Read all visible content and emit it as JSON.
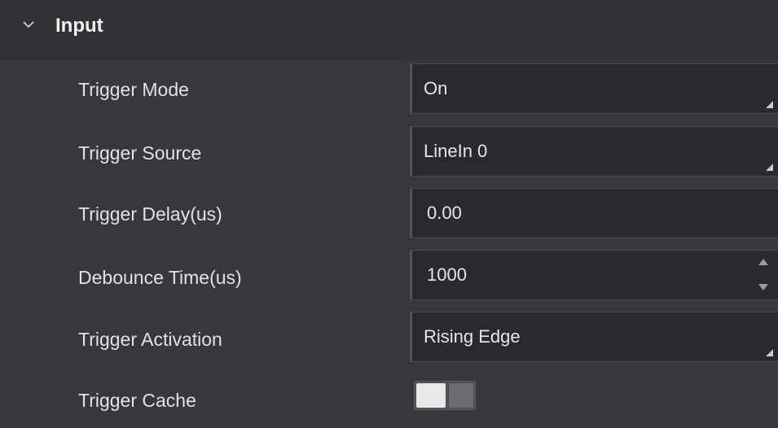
{
  "section": {
    "title": "Input",
    "expanded": true,
    "chevron_icon": "chevron-down-icon"
  },
  "rows": [
    {
      "label": "Trigger Mode",
      "value": "On",
      "control": "dropdown"
    },
    {
      "label": "Trigger Source",
      "value": "LineIn 0",
      "control": "dropdown"
    },
    {
      "label": "Trigger Delay(us)",
      "value": "0.00",
      "control": "text-input"
    },
    {
      "label": "Debounce Time(us)",
      "value": "1000",
      "control": "spinbox"
    },
    {
      "label": "Trigger Activation",
      "value": "Rising Edge",
      "control": "dropdown"
    },
    {
      "label": "Trigger Cache",
      "control": "toggle",
      "toggle_on": false
    }
  ],
  "colors": {
    "panel_background": "#37373c",
    "header_background": "#313136",
    "field_background": "#2a2a2e",
    "text": "#e2e2e2"
  }
}
